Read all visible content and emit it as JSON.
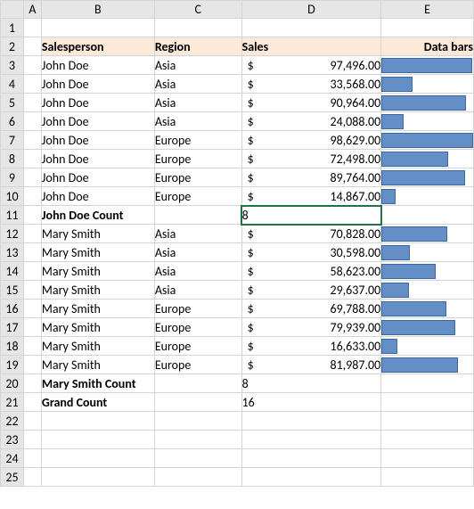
{
  "colHeaders": [
    "A",
    "B",
    "C",
    "D",
    "E"
  ],
  "rowHeaders": [
    "1",
    "2",
    "3",
    "4",
    "5",
    "6",
    "7",
    "8",
    "9",
    "10",
    "11",
    "12",
    "13",
    "14",
    "15",
    "16",
    "17",
    "18",
    "19",
    "20",
    "21",
    "22",
    "23",
    "24",
    "25"
  ],
  "title": {
    "sales": "Salesperson",
    "region": "Region",
    "salescol": "Sales",
    "bars": "Data bars"
  },
  "rows": [
    {
      "type": "data",
      "person": "John Doe",
      "region": "Asia",
      "sales": 97496.0,
      "barPct": 99
    },
    {
      "type": "data",
      "person": "John Doe",
      "region": "Asia",
      "sales": 33568.0,
      "barPct": 34
    },
    {
      "type": "data",
      "person": "John Doe",
      "region": "Asia",
      "sales": 90964.0,
      "barPct": 92
    },
    {
      "type": "data",
      "person": "John Doe",
      "region": "Asia",
      "sales": 24088.0,
      "barPct": 24
    },
    {
      "type": "data",
      "person": "John Doe",
      "region": "Europe",
      "sales": 98629.0,
      "barPct": 100
    },
    {
      "type": "data",
      "person": "John Doe",
      "region": "Europe",
      "sales": 72498.0,
      "barPct": 73
    },
    {
      "type": "data",
      "person": "John Doe",
      "region": "Europe",
      "sales": 89764.0,
      "barPct": 91
    },
    {
      "type": "data",
      "person": "John Doe",
      "region": "Europe",
      "sales": 14867.0,
      "barPct": 15
    },
    {
      "type": "subtotal",
      "label": "John Doe Count",
      "count": 8,
      "active": true
    },
    {
      "type": "data",
      "person": "Mary Smith",
      "region": "Asia",
      "sales": 70828.0,
      "barPct": 72
    },
    {
      "type": "data",
      "person": "Mary Smith",
      "region": "Asia",
      "sales": 30598.0,
      "barPct": 31
    },
    {
      "type": "data",
      "person": "Mary Smith",
      "region": "Asia",
      "sales": 58623.0,
      "barPct": 59
    },
    {
      "type": "data",
      "person": "Mary Smith",
      "region": "Asia",
      "sales": 29637.0,
      "barPct": 30
    },
    {
      "type": "data",
      "person": "Mary Smith",
      "region": "Europe",
      "sales": 69788.0,
      "barPct": 71
    },
    {
      "type": "data",
      "person": "Mary Smith",
      "region": "Europe",
      "sales": 79939.0,
      "barPct": 81
    },
    {
      "type": "data",
      "person": "Mary Smith",
      "region": "Europe",
      "sales": 16633.0,
      "barPct": 17
    },
    {
      "type": "data",
      "person": "Mary Smith",
      "region": "Europe",
      "sales": 81987.0,
      "barPct": 83
    },
    {
      "type": "subtotal",
      "label": "Mary Smith Count",
      "count": 8
    },
    {
      "type": "grand",
      "label": "Grand Count",
      "count": 16
    }
  ],
  "currency": "$",
  "activeCell": "D11",
  "colors": {
    "header": "#fde9d9",
    "bar": "#638ec6",
    "barBorder": "#3c67a0",
    "selection": "#217346"
  },
  "chart_data": {
    "type": "bar",
    "title": "Data bars",
    "xlabel": "",
    "ylabel": "Sales",
    "ylim": [
      0,
      100000
    ],
    "series": [
      {
        "name": "John Doe Asia",
        "values": [
          97496,
          33568,
          90964,
          24088
        ]
      },
      {
        "name": "John Doe Europe",
        "values": [
          98629,
          72498,
          89764,
          14867
        ]
      },
      {
        "name": "Mary Smith Asia",
        "values": [
          70828,
          30598,
          58623,
          29637
        ]
      },
      {
        "name": "Mary Smith Europe",
        "values": [
          69788,
          79939,
          16633,
          81987
        ]
      }
    ]
  }
}
